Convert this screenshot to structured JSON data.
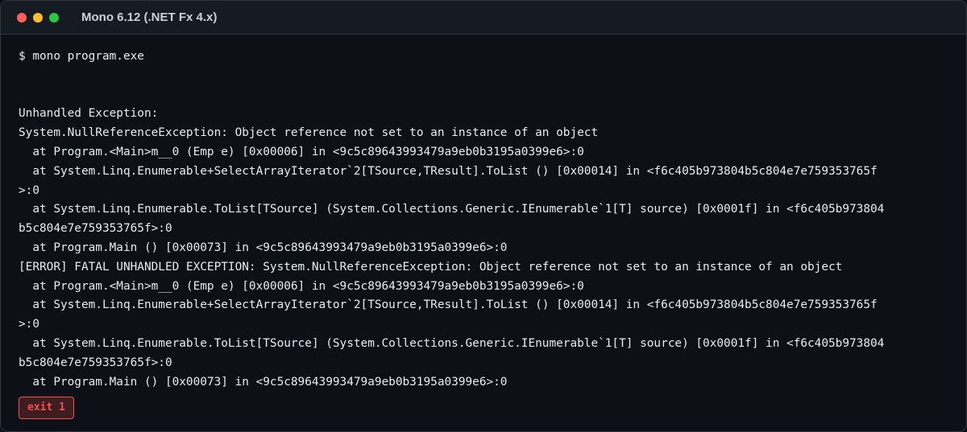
{
  "window": {
    "title": "Mono 6.12 (.NET Fx 4.x)",
    "controls": [
      {
        "name": "close",
        "color": "#ff5f57"
      },
      {
        "name": "minimize",
        "color": "#febc2e"
      },
      {
        "name": "maximize",
        "color": "#28c840"
      }
    ]
  },
  "terminal": {
    "command": "$ mono program.exe",
    "output": [
      "Unhandled Exception:",
      "System.NullReferenceException: Object reference not set to an instance of an object",
      "  at Program.<Main>m__0 (Emp e) [0x00006] in <9c5c89643993479a9eb0b3195a0399e6>:0",
      "  at System.Linq.Enumerable+SelectArrayIterator`2[TSource,TResult].ToList () [0x00014] in <f6c405b973804b5c804e7e759353765f",
      ">:0",
      "  at System.Linq.Enumerable.ToList[TSource] (System.Collections.Generic.IEnumerable`1[T] source) [0x0001f] in <f6c405b973804",
      "b5c804e7e759353765f>:0",
      "  at Program.Main () [0x00073] in <9c5c89643993479a9eb0b3195a0399e6>:0",
      "[ERROR] FATAL UNHANDLED EXCEPTION: System.NullReferenceException: Object reference not set to an instance of an object",
      "  at Program.<Main>m__0 (Emp e) [0x00006] in <9c5c89643993479a9eb0b3195a0399e6>:0",
      "  at System.Linq.Enumerable+SelectArrayIterator`2[TSource,TResult].ToList () [0x00014] in <f6c405b973804b5c804e7e759353765f",
      ">:0",
      "  at System.Linq.Enumerable.ToList[TSource] (System.Collections.Generic.IEnumerable`1[T] source) [0x0001f] in <f6c405b973804",
      "b5c804e7e759353765f>:0",
      "  at Program.Main () [0x00073] in <9c5c89643993479a9eb0b3195a0399e6>:0"
    ],
    "exit_label": "exit 1"
  }
}
